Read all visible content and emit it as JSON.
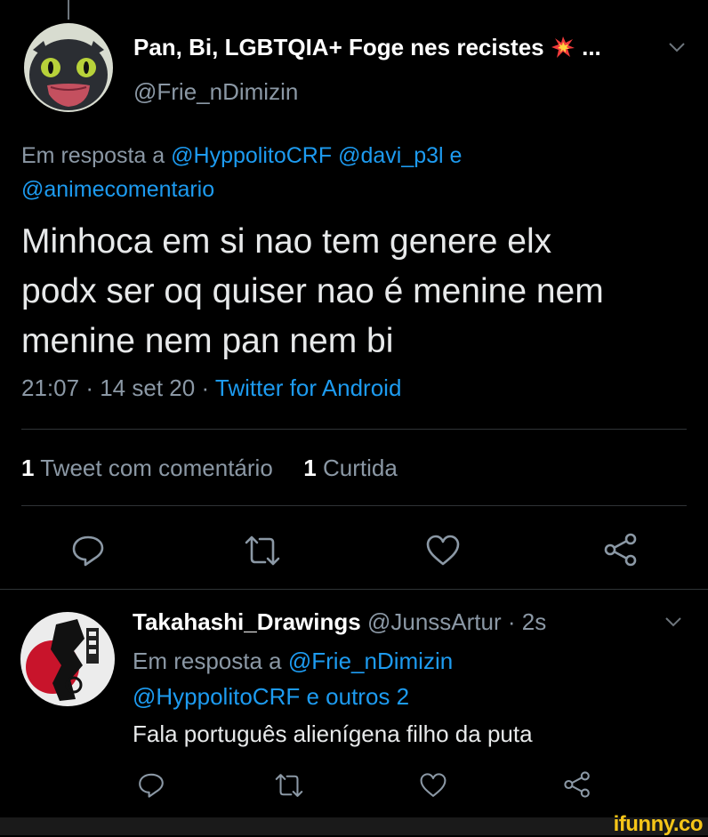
{
  "main_tweet": {
    "display_name": "Pan, Bi, LGBTQIA+ Foge nes recistes",
    "name_suffix": "...",
    "handle": "@Frie_nDimizin",
    "reply_prefix": "Em resposta a",
    "reply_to_1": "@HyppolitoCRF",
    "reply_to_2": "@davi_p3l",
    "reply_conj": "e",
    "reply_to_3": "@animecomentario",
    "text_line1": "Minhoca em si nao tem genere elx",
    "text_line2": "podx ser oq quiser nao é menine nem",
    "text_line3": "menine nem pan nem bi",
    "time": "21:07",
    "date": "14 set 20",
    "sep": "·",
    "source": "Twitter for Android",
    "quote_count": "1",
    "quote_label": "Tweet com comentário",
    "like_count": "1",
    "like_label": "Curtida"
  },
  "reply_tweet": {
    "display_name": "Takahashi_Drawings",
    "handle": "@JunssArtur",
    "sep": "·",
    "time": "2s",
    "reply_prefix": "Em resposta a",
    "reply_to_1": "@Frie_nDimizin",
    "reply_to_2": "@HyppolitoCRF",
    "reply_others": "e outros 2",
    "text": "Fala português alienígena filho da puta"
  },
  "watermark": "ifunny.co",
  "colors": {
    "accent": "#1d9bf0",
    "muted": "#8b98a5",
    "text": "#e7e9ea",
    "background": "#000000"
  },
  "icons": [
    "chevron-down-icon",
    "reply-icon",
    "retweet-icon",
    "like-icon",
    "share-icon",
    "explosion-emoji-icon"
  ]
}
